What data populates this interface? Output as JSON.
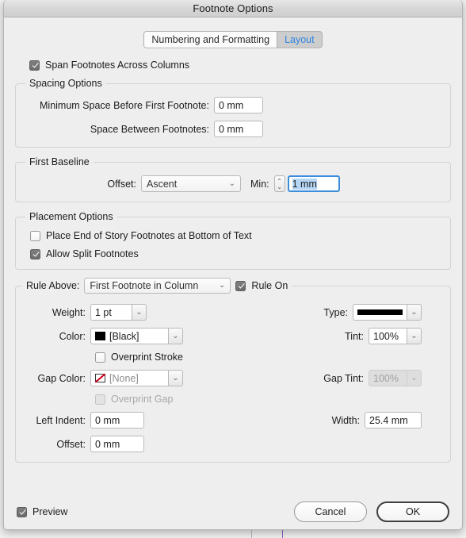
{
  "window": {
    "title": "Footnote Options"
  },
  "tabs": [
    {
      "label": "Numbering and Formatting",
      "selected": false
    },
    {
      "label": "Layout",
      "selected": true
    }
  ],
  "span_footnotes": {
    "label": "Span Footnotes Across Columns",
    "checked": true
  },
  "spacing_options": {
    "legend": "Spacing Options",
    "min_space_label": "Minimum Space Before First Footnote:",
    "min_space_value": "0 mm",
    "space_between_label": "Space Between Footnotes:",
    "space_between_value": "0 mm"
  },
  "first_baseline": {
    "legend": "First Baseline",
    "offset_label": "Offset:",
    "offset_value": "Ascent",
    "min_label": "Min:",
    "min_value": "1 mm"
  },
  "placement_options": {
    "legend": "Placement Options",
    "place_end_label": "Place End of Story Footnotes at Bottom of Text",
    "place_end_checked": false,
    "allow_split_label": "Allow Split Footnotes",
    "allow_split_checked": true
  },
  "rule_above": {
    "legend": "Rule Above:",
    "rule_value": "First Footnote in Column",
    "rule_on_label": "Rule On",
    "rule_on_checked": true,
    "weight_label": "Weight:",
    "weight_value": "1 pt",
    "type_label": "Type:",
    "type_value": "solid-line-swatch",
    "color_label": "Color:",
    "color_value": "[Black]",
    "tint_label": "Tint:",
    "tint_value": "100%",
    "overprint_stroke_label": "Overprint Stroke",
    "overprint_stroke_checked": false,
    "gap_color_label": "Gap Color:",
    "gap_color_value": "[None]",
    "gap_tint_label": "Gap Tint:",
    "gap_tint_value": "100%",
    "overprint_gap_label": "Overprint Gap",
    "overprint_gap_checked": false,
    "left_indent_label": "Left Indent:",
    "left_indent_value": "0 mm",
    "width_label": "Width:",
    "width_value": "25.4 mm",
    "offset_label": "Offset:",
    "offset_value": "0 mm"
  },
  "footer": {
    "preview_label": "Preview",
    "preview_checked": true,
    "cancel_label": "Cancel",
    "ok_label": "OK"
  },
  "colors": {
    "accent": "#2f84e0",
    "focus_border": "#3c8ddc",
    "selection": "#b5d6f5",
    "swatch_none_slash": "#d0021b"
  }
}
